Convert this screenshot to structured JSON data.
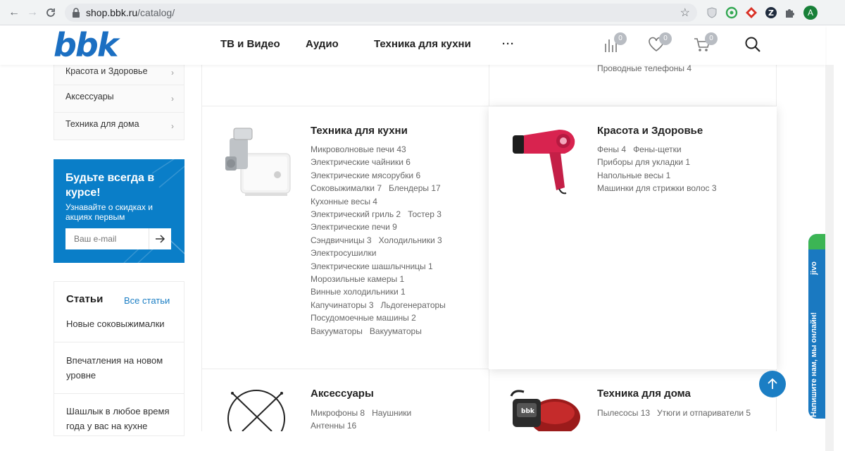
{
  "browser": {
    "url_host": "shop.bbk.ru",
    "url_path": "/catalog/",
    "profile_initial": "A"
  },
  "header": {
    "logo_text": "bbk",
    "nav": [
      "ТВ и Видео",
      "Аудио",
      "Техника для кухни"
    ],
    "more": "···",
    "compare_count": "0",
    "wishlist_count": "0",
    "cart_count": "0"
  },
  "sidebar": {
    "items": [
      "Красота и Здоровье",
      "Аксессуары",
      "Техника для дома"
    ],
    "promo": {
      "title": "Будьте всегда в курсе!",
      "text": "Узнавайте о скидках и акциях первым",
      "email_placeholder": "Ваш e-mail"
    },
    "articles": {
      "title": "Статьи",
      "all_link": "Все статьи",
      "items": [
        "Новые соковыжималки",
        "Впечатления на новом уровне",
        "Шашлык в любое время года у вас на кухне"
      ]
    }
  },
  "catalog": {
    "top_right_sub": "Проводные телефоны 4",
    "kitchen": {
      "title": "Техника для кухни",
      "rows": [
        [
          "Микроволновые печи 43"
        ],
        [
          "Электрические чайники 6"
        ],
        [
          "Электрические мясорубки 6"
        ],
        [
          "Соковыжималки 7",
          "Блендеры 17"
        ],
        [
          "Кухонные весы 4"
        ],
        [
          "Электрический гриль 2",
          "Тостер 3"
        ],
        [
          "Электрические печи 9"
        ],
        [
          "Сэндвичницы 3",
          "Холодильники 3"
        ],
        [
          "Электросушилки"
        ],
        [
          "Электрические шашлычницы 1"
        ],
        [
          "Морозильные камеры 1"
        ],
        [
          "Винные холодильники 1"
        ],
        [
          "Капучинаторы 3",
          "Льдогенераторы"
        ],
        [
          "Посудомоечные машины 2"
        ],
        [
          "Вакууматоры",
          "Вакууматоры"
        ]
      ]
    },
    "beauty": {
      "title": "Красота и Здоровье",
      "rows": [
        [
          "Фены 4",
          "Фены-щетки"
        ],
        [
          "Приборы для укладки 1"
        ],
        [
          "Напольные весы 1"
        ],
        [
          "Машинки для стрижки волос 3"
        ]
      ]
    },
    "accessories": {
      "title": "Аксессуары",
      "rows": [
        [
          "Микрофоны 8",
          "Наушники"
        ],
        [
          "Антенны 16"
        ]
      ]
    },
    "home": {
      "title": "Техника для дома",
      "rows": [
        [
          "Пылесосы 13",
          "Утюги и отпариватели 5"
        ]
      ]
    }
  },
  "widgets": {
    "up_arrow": "↑",
    "jivo_logo": "jivo",
    "jivo_text": "Напишите нам, мы онлайн!"
  },
  "colors": {
    "brand_blue": "#1b6fc2",
    "promo_blue": "#0a7ec8",
    "hairdryer_red": "#d8234f"
  }
}
